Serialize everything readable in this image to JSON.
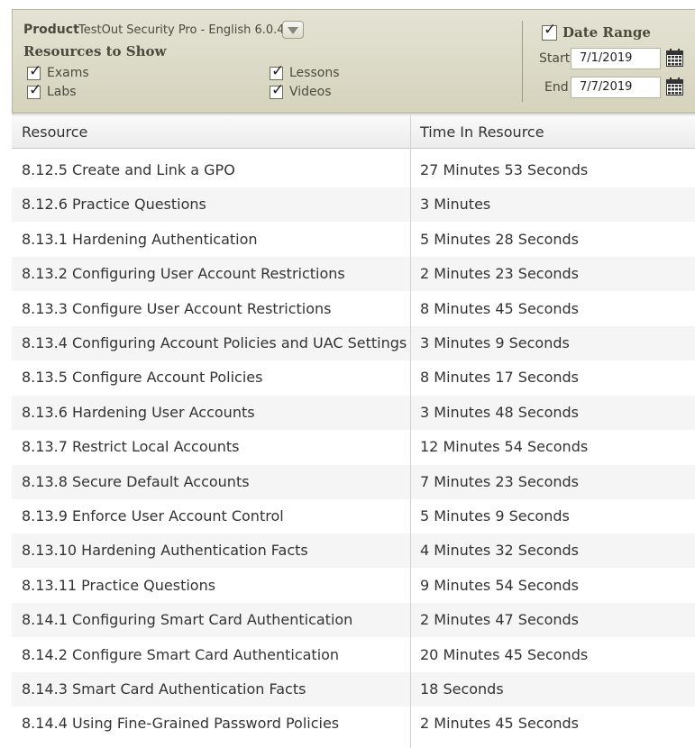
{
  "filters": {
    "product_label": "Product",
    "product_value": "TestOut Security Pro - English 6.0.4",
    "resources_title": "Resources to Show",
    "resource_types": [
      {
        "label": "Exams",
        "checked": true
      },
      {
        "label": "Lessons",
        "checked": true
      },
      {
        "label": "Labs",
        "checked": true
      },
      {
        "label": "Videos",
        "checked": true
      }
    ],
    "check_mark": "✓",
    "date_range": {
      "label": "Date Range",
      "checked": true,
      "start_label": "Start",
      "start_value": "7/1/2019",
      "end_label": "End",
      "end_value": "7/7/2019"
    }
  },
  "table": {
    "columns": [
      "Resource",
      "Time In Resource"
    ],
    "rows": [
      {
        "resource": "8.12.5 Create and Link a GPO",
        "time": "27 Minutes 53 Seconds"
      },
      {
        "resource": "8.12.6 Practice Questions",
        "time": "3 Minutes"
      },
      {
        "resource": "8.13.1 Hardening Authentication",
        "time": "5 Minutes 28 Seconds"
      },
      {
        "resource": "8.13.2 Configuring User Account Restrictions",
        "time": "2 Minutes 23 Seconds"
      },
      {
        "resource": "8.13.3 Configure User Account Restrictions",
        "time": "8 Minutes 45 Seconds"
      },
      {
        "resource": "8.13.4 Configuring Account Policies and UAC Settings",
        "time": "3 Minutes 9 Seconds"
      },
      {
        "resource": "8.13.5 Configure Account Policies",
        "time": "8 Minutes 17 Seconds"
      },
      {
        "resource": "8.13.6 Hardening User Accounts",
        "time": "3 Minutes 48 Seconds"
      },
      {
        "resource": "8.13.7 Restrict Local Accounts",
        "time": "12 Minutes 54 Seconds"
      },
      {
        "resource": "8.13.8 Secure Default Accounts",
        "time": "7 Minutes 23 Seconds"
      },
      {
        "resource": "8.13.9 Enforce User Account Control",
        "time": "5 Minutes 9 Seconds"
      },
      {
        "resource": "8.13.10 Hardening Authentication Facts",
        "time": "4 Minutes 32 Seconds"
      },
      {
        "resource": "8.13.11 Practice Questions",
        "time": "9 Minutes 54 Seconds"
      },
      {
        "resource": "8.14.1 Configuring Smart Card Authentication",
        "time": "2 Minutes 47 Seconds"
      },
      {
        "resource": "8.14.2 Configure Smart Card Authentication",
        "time": "20 Minutes 45 Seconds"
      },
      {
        "resource": "8.14.3 Smart Card Authentication Facts",
        "time": "18 Seconds"
      },
      {
        "resource": "8.14.4 Using Fine-Grained Password Policies",
        "time": "2 Minutes 45 Seconds"
      }
    ]
  },
  "icons": {
    "dropdown": "chevron-down-icon",
    "calendar": "calendar-icon",
    "checkbox": "checkbox-checked-icon"
  },
  "colors": {
    "panel_bg": "#dcdac6",
    "row_alt": "#f5f5f5",
    "text": "#333333"
  }
}
